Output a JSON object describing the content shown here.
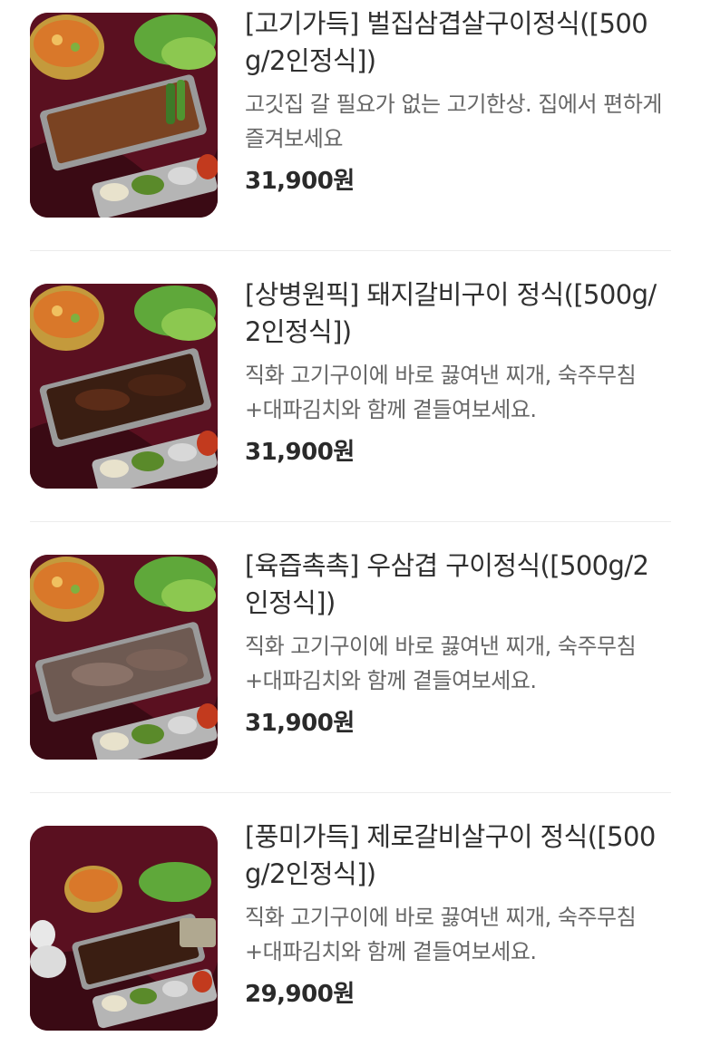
{
  "menu": {
    "items": [
      {
        "title": "[고기가득] 벌집삼겹살구이정식([500g/2인정식])",
        "description": "고깃집 갈 필요가 없는 고기한상. 집에서 편하게 즐겨보세요",
        "price": "31,900원",
        "image_alt": "벌집삼겹살구이정식 사진"
      },
      {
        "title": "[상병원픽] 돼지갈비구이 정식([500g/2인정식])",
        "description": "직화 고기구이에 바로 끓여낸 찌개, 숙주무침+대파김치와 함께 곁들여보세요.",
        "price": "31,900원",
        "image_alt": "돼지갈비구이 정식 사진"
      },
      {
        "title": "[육즙촉촉] 우삼겹 구이정식([500g/2인정식])",
        "description": "직화 고기구이에 바로 끓여낸 찌개, 숙주무침+대파김치와 함께 곁들여보세요.",
        "price": "31,900원",
        "image_alt": "우삼겹 구이정식 사진"
      },
      {
        "title": "[풍미가득] 제로갈비살구이 정식([500g/2인정식])",
        "description": "직화 고기구이에 바로 끓여낸 찌개, 숙주무침+대파김치와 함께 곁들여보세요.",
        "price": "29,900원",
        "image_alt": "제로갈비살구이 정식 사진"
      }
    ]
  }
}
